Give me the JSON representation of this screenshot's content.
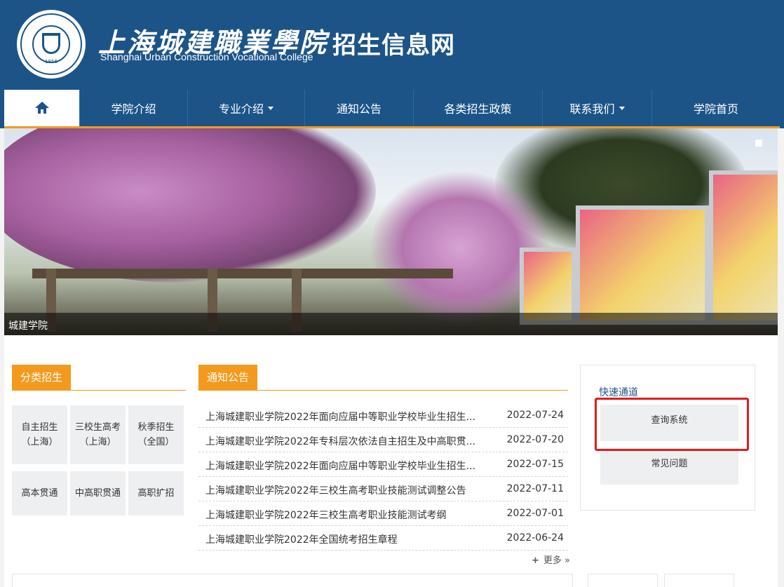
{
  "header": {
    "college_cn": "上海城建職業學院",
    "college_en": "Shanghai Urban Construction Vocational College",
    "logo_year": "1956",
    "site_title": "招生信息网"
  },
  "nav": {
    "home_icon": "home-icon",
    "items": [
      {
        "label": "学院介绍",
        "dropdown": false
      },
      {
        "label": "专业介绍",
        "dropdown": true
      },
      {
        "label": "通知公告",
        "dropdown": false
      },
      {
        "label": "各类招生政策",
        "dropdown": false
      },
      {
        "label": "联系我们",
        "dropdown": true
      },
      {
        "label": "学院首页",
        "dropdown": false
      }
    ]
  },
  "banner": {
    "caption": "城建学院"
  },
  "categories": {
    "title": "分类招生",
    "items": [
      {
        "line1": "自主招生",
        "line2": "（上海）"
      },
      {
        "line1": "三校生高考",
        "line2": "（上海）"
      },
      {
        "line1": "秋季招生",
        "line2": "（全国）"
      },
      {
        "line1": "高本贯通",
        "line2": ""
      },
      {
        "line1": "中高职贯通",
        "line2": ""
      },
      {
        "line1": "高职扩招",
        "line2": ""
      }
    ]
  },
  "notices": {
    "title": "通知公告",
    "items": [
      {
        "title": "上海城建职业学院2022年面向应届中等职业学校毕业生招生...",
        "date": "2022-07-24"
      },
      {
        "title": "上海城建职业学院2022年专科层次依法自主招生及中高职贯...",
        "date": "2022-07-20"
      },
      {
        "title": "上海城建职业学院2022年面向应届中等职业学校毕业生招生...",
        "date": "2022-07-15"
      },
      {
        "title": "上海城建职业学院2022年三校生高考职业技能测试调整公告",
        "date": "2022-07-11"
      },
      {
        "title": "上海城建职业学院2022年三校生高考职业技能测试考纲",
        "date": "2022-07-01"
      },
      {
        "title": "上海城建职业学院2022年全国统考招生章程",
        "date": "2022-06-24"
      }
    ],
    "more_label": "更多 »"
  },
  "quick": {
    "title": "快速通道",
    "buttons": [
      "查询系统",
      "常见问题"
    ],
    "highlight_color": "#e21d1d"
  },
  "colors": {
    "brand_blue": "#1c5488",
    "accent_orange": "#f39a1e"
  }
}
